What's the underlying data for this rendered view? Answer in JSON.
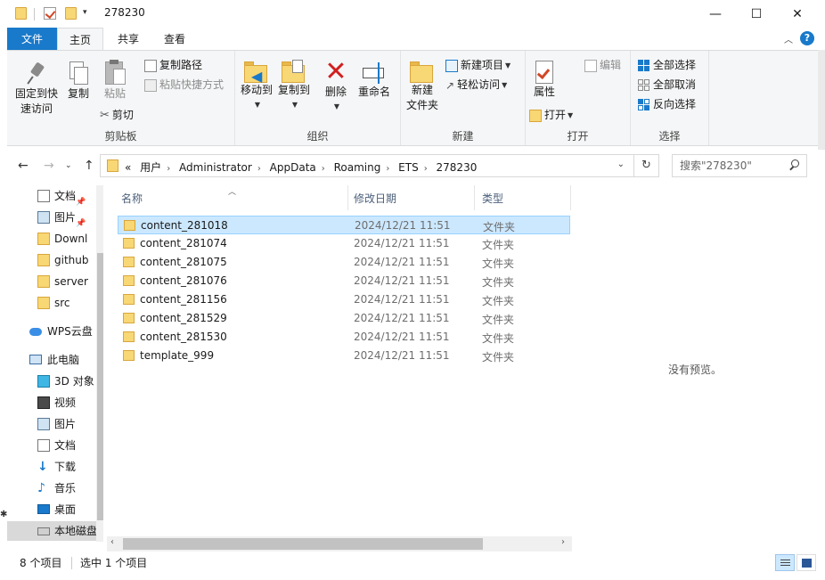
{
  "window": {
    "title": "278230",
    "minimize": "—",
    "maximize": "☐",
    "close": "✕"
  },
  "tabs": [
    "文件",
    "主页",
    "共享",
    "查看"
  ],
  "ribbon": {
    "clipboard": {
      "group_label": "剪贴板",
      "pin_label_1": "固定到快",
      "pin_label_2": "速访问",
      "copy": "复制",
      "paste": "粘贴",
      "copy_path": "复制路径",
      "paste_shortcut": "粘贴快捷方式",
      "cut": "剪切"
    },
    "organize": {
      "group_label": "组织",
      "move_to": "移动到",
      "copy_to": "复制到",
      "delete": "删除",
      "rename": "重命名"
    },
    "new": {
      "group_label": "新建",
      "new_folder_1": "新建",
      "new_folder_2": "文件夹",
      "new_item": "新建项目",
      "easy_access": "轻松访问"
    },
    "open": {
      "group_label": "打开",
      "properties": "属性",
      "open": "打开",
      "edit": "编辑"
    },
    "select": {
      "group_label": "选择",
      "select_all": "全部选择",
      "select_none": "全部取消",
      "invert": "反向选择"
    }
  },
  "address": {
    "prefix": "«",
    "crumbs": [
      "用户",
      "Administrator",
      "AppData",
      "Roaming",
      "ETS",
      "278230"
    ]
  },
  "search": {
    "placeholder": "搜索\"278230\""
  },
  "nav": [
    {
      "label": "文档",
      "icon": "documents-icon",
      "pinned": true
    },
    {
      "label": "图片",
      "icon": "pictures-icon",
      "pinned": true
    },
    {
      "label": "Downl",
      "icon": "folder-icon",
      "pinned": false
    },
    {
      "label": "github",
      "icon": "folder-icon",
      "pinned": false
    },
    {
      "label": "server",
      "icon": "folder-icon",
      "pinned": false
    },
    {
      "label": "src",
      "icon": "folder-icon",
      "pinned": false
    },
    {
      "label": "WPS云盘",
      "icon": "cloud-icon",
      "pinned": false
    },
    {
      "label": "此电脑",
      "icon": "computer-icon",
      "pinned": false
    },
    {
      "label": "3D 对象",
      "icon": "3d-objects-icon",
      "pinned": false
    },
    {
      "label": "视频",
      "icon": "videos-icon",
      "pinned": false
    },
    {
      "label": "图片",
      "icon": "pictures-icon",
      "pinned": false
    },
    {
      "label": "文档",
      "icon": "documents-icon",
      "pinned": false
    },
    {
      "label": "下载",
      "icon": "downloads-icon",
      "pinned": false
    },
    {
      "label": "音乐",
      "icon": "music-icon",
      "pinned": false
    },
    {
      "label": "桌面",
      "icon": "desktop-icon",
      "pinned": false
    },
    {
      "label": "本地磁盘",
      "icon": "drive-icon",
      "pinned": false
    }
  ],
  "columns": {
    "name": "名称",
    "date": "修改日期",
    "type": "类型"
  },
  "files": [
    {
      "name": "content_281018",
      "date": "2024/12/21 11:51",
      "type": "文件夹",
      "selected": true
    },
    {
      "name": "content_281074",
      "date": "2024/12/21 11:51",
      "type": "文件夹",
      "selected": false
    },
    {
      "name": "content_281075",
      "date": "2024/12/21 11:51",
      "type": "文件夹",
      "selected": false
    },
    {
      "name": "content_281076",
      "date": "2024/12/21 11:51",
      "type": "文件夹",
      "selected": false
    },
    {
      "name": "content_281156",
      "date": "2024/12/21 11:51",
      "type": "文件夹",
      "selected": false
    },
    {
      "name": "content_281529",
      "date": "2024/12/21 11:51",
      "type": "文件夹",
      "selected": false
    },
    {
      "name": "content_281530",
      "date": "2024/12/21 11:51",
      "type": "文件夹",
      "selected": false
    },
    {
      "name": "template_999",
      "date": "2024/12/21 11:51",
      "type": "文件夹",
      "selected": false
    }
  ],
  "preview": {
    "empty_text": "没有预览。"
  },
  "status": {
    "item_count": "8 个项目",
    "selected_count": "选中 1 个项目"
  },
  "colors": {
    "accent": "#1979ca",
    "selection": "#cce8ff",
    "folder": "#f8d775",
    "delete": "#d11f1f"
  }
}
